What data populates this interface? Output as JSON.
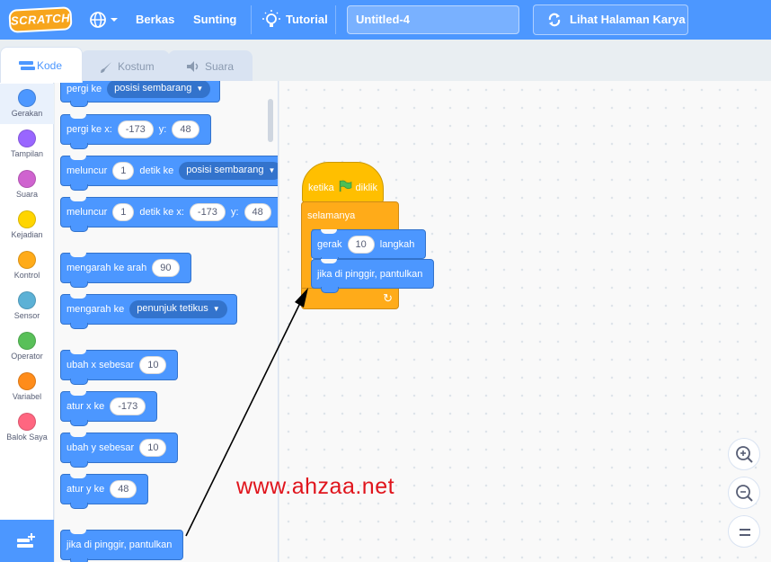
{
  "menubar": {
    "logo_text": "SCRATCH",
    "file_label": "Berkas",
    "edit_label": "Sunting",
    "tutorial_label": "Tutorial",
    "project_title": "Untitled-4",
    "see_project_label": "Lihat Halaman Karya"
  },
  "tabs": [
    {
      "label": "Kode",
      "icon": "code-icon"
    },
    {
      "label": "Kostum",
      "icon": "brush-icon"
    },
    {
      "label": "Suara",
      "icon": "speaker-icon"
    }
  ],
  "categories": [
    {
      "label": "Gerakan",
      "color": "#4c97ff"
    },
    {
      "label": "Tampilan",
      "color": "#9966ff"
    },
    {
      "label": "Suara",
      "color": "#cf63cf"
    },
    {
      "label": "Kejadian",
      "color": "#ffd500"
    },
    {
      "label": "Kontrol",
      "color": "#ffab19"
    },
    {
      "label": "Sensor",
      "color": "#5cb1d6"
    },
    {
      "label": "Operator",
      "color": "#59c059"
    },
    {
      "label": "Variabel",
      "color": "#ff8c1a"
    },
    {
      "label": "Balok Saya",
      "color": "#ff6680"
    }
  ],
  "palette": {
    "goto": {
      "text": "pergi ke",
      "dropdown": "posisi sembarang"
    },
    "goto_xy": {
      "text": "pergi ke x:",
      "x": "-173",
      "ylabel": "y:",
      "y": "48"
    },
    "glide": {
      "text": "meluncur",
      "secs": "1",
      "mid": "detik ke",
      "dropdown": "posisi sembarang"
    },
    "glide_xy": {
      "text": "meluncur",
      "secs": "1",
      "mid": "detik ke x:",
      "x": "-173",
      "ylabel": "y:",
      "y": "48"
    },
    "point_dir": {
      "text": "mengarah ke arah",
      "value": "90"
    },
    "point_towards": {
      "text": "mengarah ke",
      "dropdown": "penunjuk tetikus"
    },
    "change_x": {
      "text": "ubah x sebesar",
      "value": "10"
    },
    "set_x": {
      "text": "atur x ke",
      "value": "-173"
    },
    "change_y": {
      "text": "ubah y sebesar",
      "value": "10"
    },
    "set_y": {
      "text": "atur y ke",
      "value": "48"
    },
    "bounce": {
      "text": "jika di pinggir, pantulkan"
    }
  },
  "script": {
    "hat_prefix": "ketika",
    "hat_suffix": "diklik",
    "forever": "selamanya",
    "move_prefix": "gerak",
    "move_value": "10",
    "move_suffix": "langkah",
    "bounce": "jika di pinggir, pantulkan"
  },
  "watermark": "www.ahzaa.net",
  "colors": {
    "motion": "#4c97ff",
    "events": "#ffbf00",
    "control": "#ffab19",
    "menubar": "#4c97ff"
  }
}
